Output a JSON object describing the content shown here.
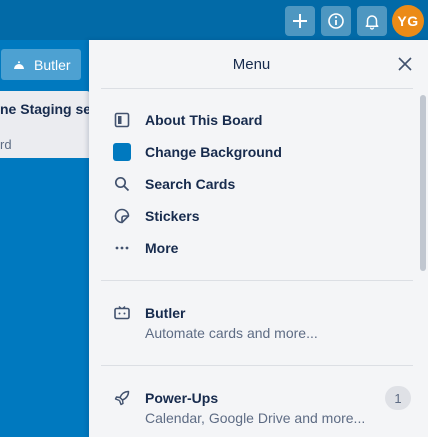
{
  "header": {
    "add_icon": "plus-icon",
    "info_icon": "info-icon",
    "notifications_icon": "bell-icon",
    "avatar_initials": "YG",
    "avatar_color": "#eb8b17"
  },
  "board": {
    "butler_button_label": "Butler",
    "list_title": "ne Staging serv",
    "list_sub": "rd",
    "background_color": "#0079bf"
  },
  "menu": {
    "title": "Menu",
    "items": [
      {
        "label": "About This Board",
        "icon": "board-icon"
      },
      {
        "label": "Change Background",
        "icon": "background-swatch"
      },
      {
        "label": "Search Cards",
        "icon": "search-icon"
      },
      {
        "label": "Stickers",
        "icon": "sticker-icon"
      },
      {
        "label": "More",
        "icon": "more-icon"
      }
    ],
    "sections": [
      {
        "label": "Butler",
        "description": "Automate cards and more...",
        "icon": "butler-icon"
      },
      {
        "label": "Power-Ups",
        "description": "Calendar, Google Drive and more...",
        "icon": "rocket-icon",
        "badge": "1"
      }
    ]
  }
}
